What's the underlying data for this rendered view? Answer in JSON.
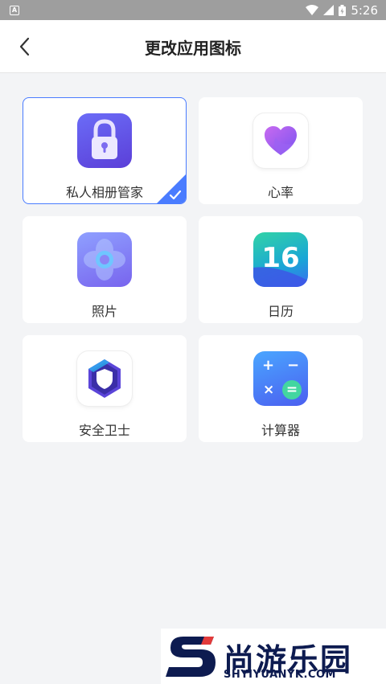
{
  "status_bar": {
    "time": "5:26",
    "app_badge": "A"
  },
  "header": {
    "title": "更改应用图标",
    "back_icon": "chevron-left-icon"
  },
  "icons": [
    {
      "label": "私人相册管家",
      "icon": "lock-icon",
      "selected": true
    },
    {
      "label": "心率",
      "icon": "heart-icon",
      "selected": false
    },
    {
      "label": "照片",
      "icon": "flower-icon",
      "selected": false
    },
    {
      "label": "日历",
      "icon": "calendar-icon",
      "number": "16",
      "selected": false
    },
    {
      "label": "安全卫士",
      "icon": "shield-icon",
      "selected": false
    },
    {
      "label": "计算器",
      "icon": "calculator-icon",
      "selected": false,
      "calc_symbols": [
        "+",
        "−",
        "×",
        "="
      ]
    }
  ],
  "watermark": {
    "text_cn": "尚游乐园",
    "text_en": "SHYIYUANYK.COM"
  },
  "colors": {
    "accent": "#4a7cff",
    "background": "#f3f4f6",
    "statusbar": "#9e9e9e"
  }
}
